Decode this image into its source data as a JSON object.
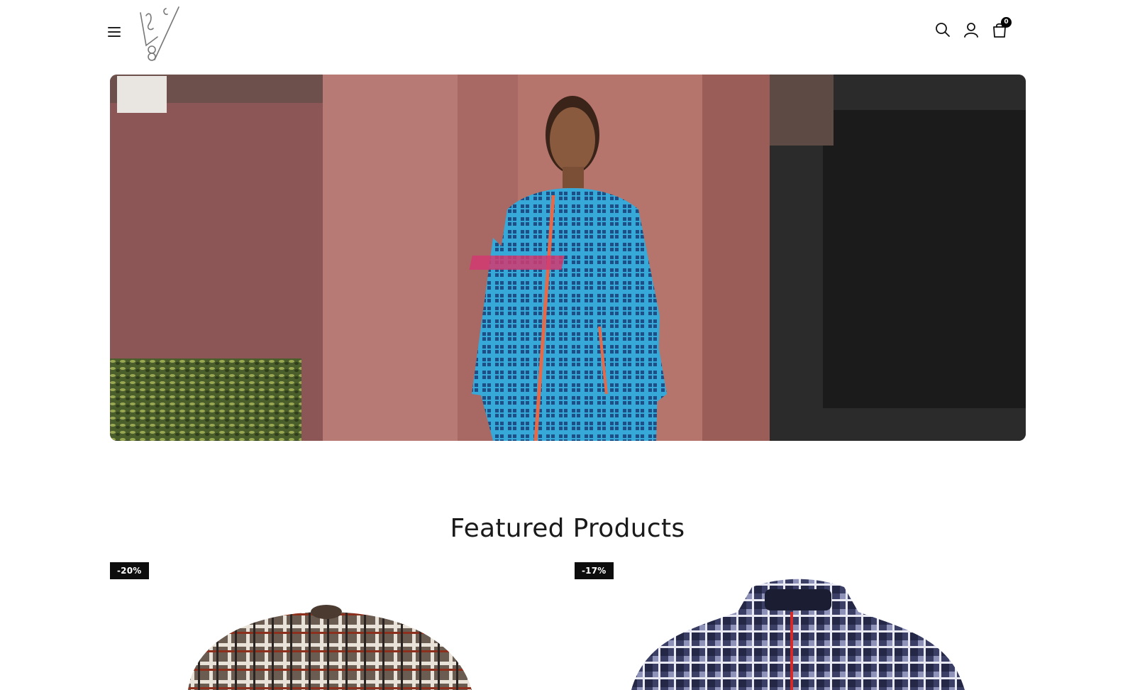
{
  "header": {
    "menu_icon": "hamburger-menu-icon",
    "logo_alt": "brand-logo",
    "icons": [
      "search-icon",
      "account-icon",
      "cart-bag-icon"
    ],
    "cart_count": "0"
  },
  "hero": {
    "image": "man in blue plaid track jacket against pink brick wall"
  },
  "featured": {
    "title": "Featured Products",
    "products": [
      {
        "badge": "-20%",
        "image": "plaid-cap-image"
      },
      {
        "badge": "-17%",
        "image": "navy-check-jacket-image"
      }
    ]
  },
  "colors": {
    "accent": "#0d0d0d",
    "background": "#ffffff",
    "text": "#1a1a1a"
  }
}
